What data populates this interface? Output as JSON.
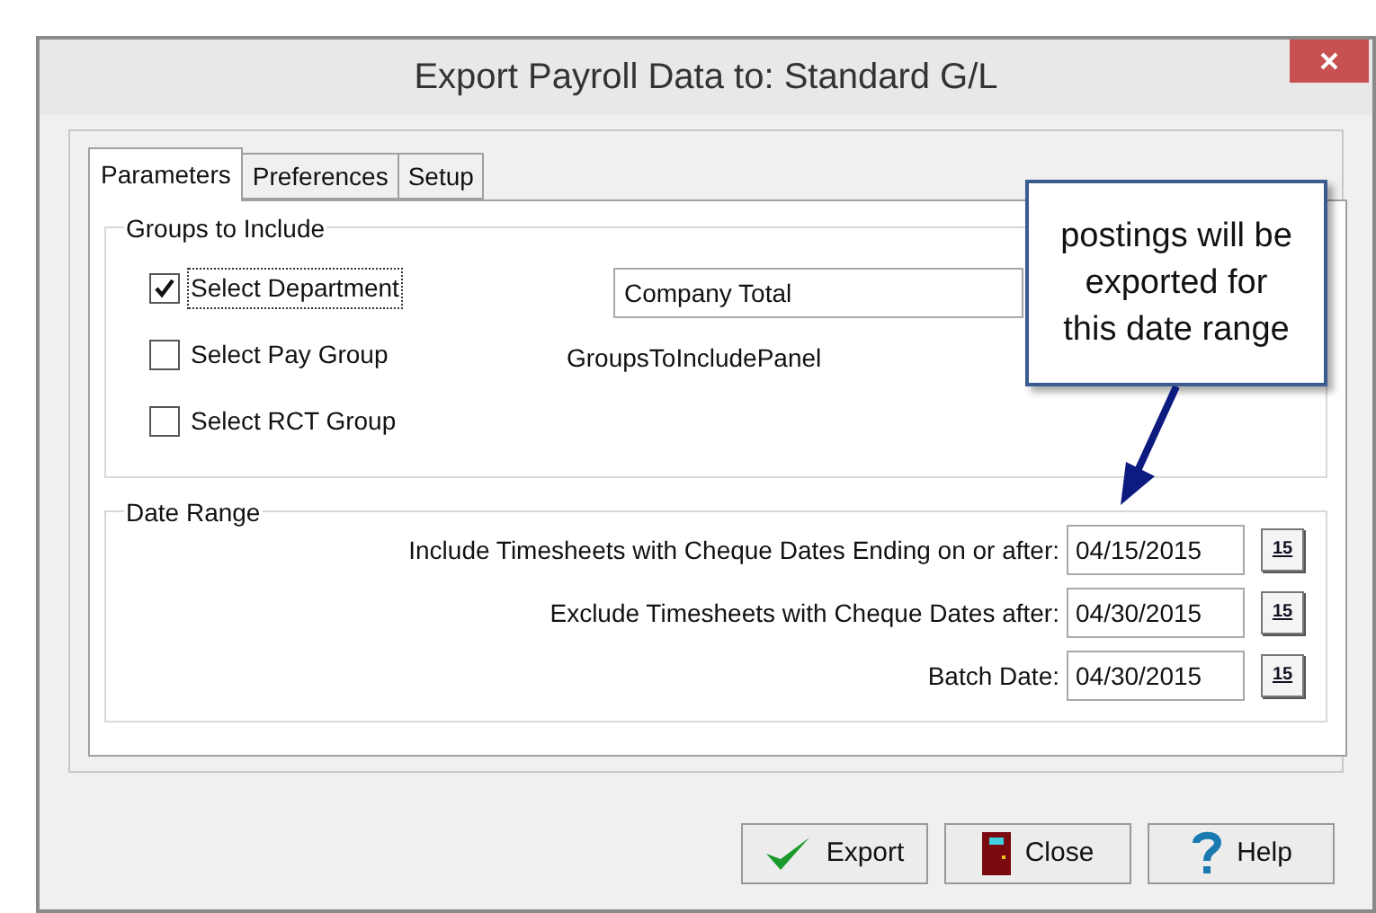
{
  "window": {
    "title": "Export Payroll Data to: Standard G/L"
  },
  "tabs": [
    {
      "label": "Parameters",
      "selected": true
    },
    {
      "label": "Preferences",
      "selected": false
    },
    {
      "label": "Setup",
      "selected": false
    }
  ],
  "groups_to_include": {
    "title": "Groups to Include",
    "options": [
      {
        "label": "Select Department",
        "checked": true,
        "focused": true
      },
      {
        "label": "Select Pay Group",
        "checked": false,
        "focused": false
      },
      {
        "label": "Select RCT Group",
        "checked": false,
        "focused": false
      }
    ],
    "selection_value": "Company Total",
    "panel_label": "GroupsToIncludePanel"
  },
  "date_range": {
    "title": "Date Range",
    "rows": [
      {
        "label": "Include Timesheets with Cheque Dates Ending on or after:",
        "value": "04/15/2015",
        "calendar_text": "15"
      },
      {
        "label": "Exclude Timesheets with Cheque Dates after:",
        "value": "04/30/2015",
        "calendar_text": "15"
      },
      {
        "label": "Batch Date:",
        "value": "04/30/2015",
        "calendar_text": "15"
      }
    ]
  },
  "buttons": [
    {
      "label": "Export",
      "kind": "export"
    },
    {
      "label": "Close",
      "kind": "close"
    },
    {
      "label": "Help",
      "kind": "help"
    }
  ],
  "callout": {
    "text": "postings will be exported for this date range"
  }
}
